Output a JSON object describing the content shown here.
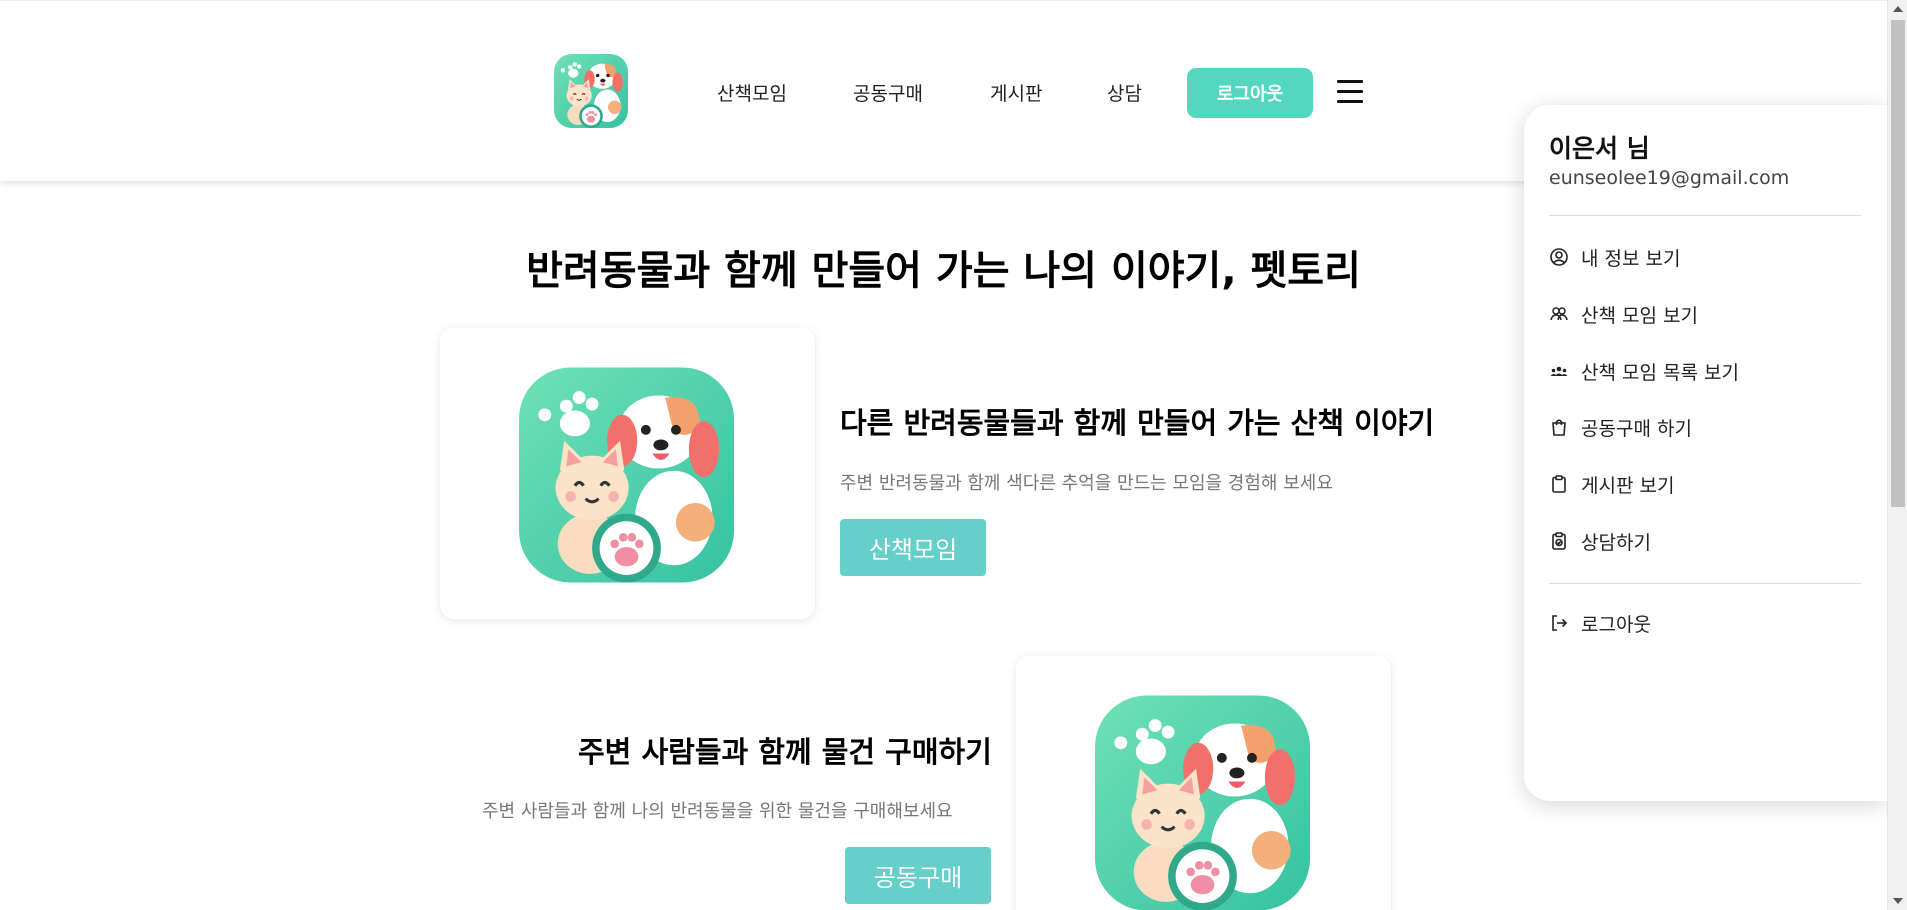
{
  "header": {
    "nav": [
      "산책모임",
      "공동구매",
      "게시판",
      "상담"
    ],
    "logout_label": "로그아웃"
  },
  "main": {
    "headline": "반려동물과 함께 만들어 가는 나의 이야기, 펫토리",
    "sections": [
      {
        "title": "다른 반려동물들과 함께 만들어 가는 산책 이야기",
        "desc": "주변 반려동물과 함께 색다른 추억을 만드는 모임을 경험해 보세요",
        "button": "산책모임"
      },
      {
        "title": "주변 사람들과 함께 물건 구매하기",
        "desc": "주변 사람들과 함께 나의 반려동물을 위한 물건을 구매해보세요",
        "button": "공동구매"
      }
    ]
  },
  "panel": {
    "user_name": "이은서 님",
    "email": "eunseolee19@gmail.com",
    "items": [
      {
        "icon": "user-circle-icon",
        "label": "내 정보 보기"
      },
      {
        "icon": "walk-group-icon",
        "label": "산책 모임 보기"
      },
      {
        "icon": "people-group-icon",
        "label": "산책 모임 목록 보기"
      },
      {
        "icon": "shopping-bag-icon",
        "label": "공동구매 하기"
      },
      {
        "icon": "clipboard-icon",
        "label": "게시판 보기"
      },
      {
        "icon": "clipboard-consult-icon",
        "label": "상담하기"
      }
    ],
    "logout_icon": "logout-icon",
    "logout_label": "로그아웃"
  },
  "colors": {
    "accent": "#55d6bf",
    "section_button": "#66cfca",
    "logo_bg": "#4fcfa6"
  }
}
